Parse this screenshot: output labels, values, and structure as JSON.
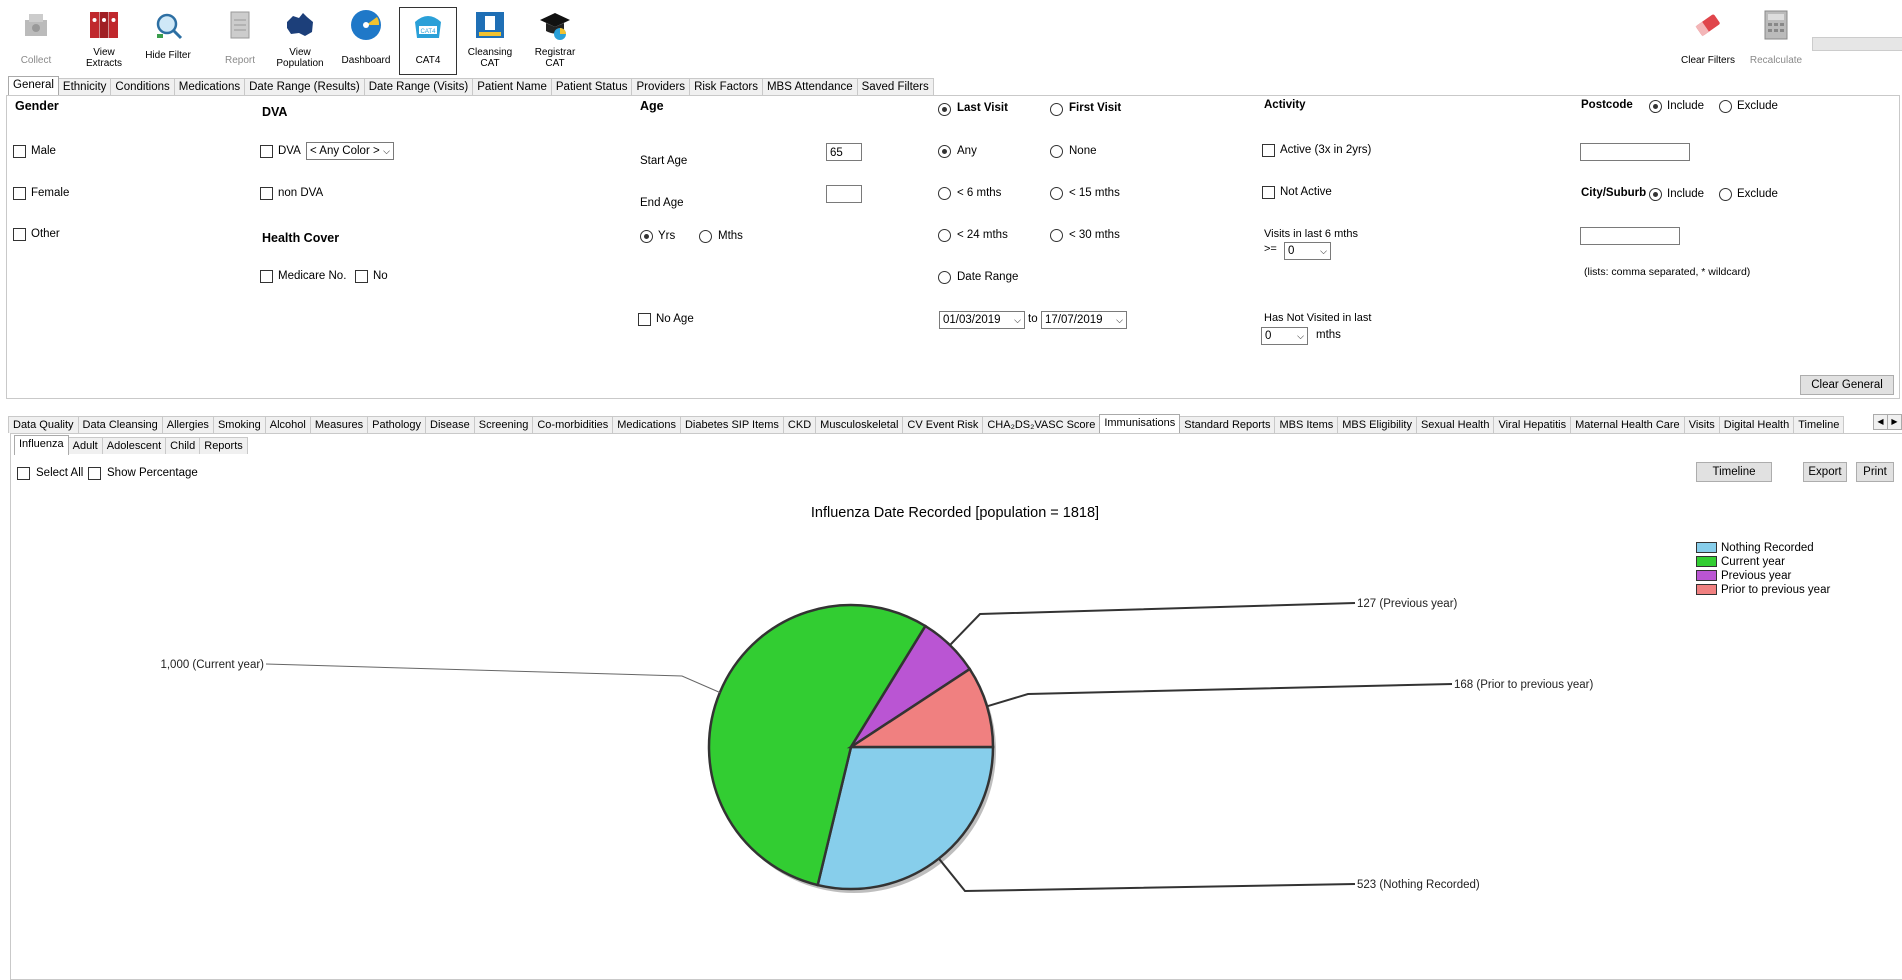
{
  "toolbar": {
    "collect": "Collect",
    "view_extracts": "View\nExtracts",
    "hide_filter": "Hide Filter",
    "report": "Report",
    "view_population": "View\nPopulation",
    "dashboard": "Dashboard",
    "cat4": "CAT4",
    "cleansing_cat": "Cleansing\nCAT",
    "registrar_cat": "Registrar\nCAT",
    "clear_filters": "Clear Filters",
    "recalculate": "Recalculate"
  },
  "filter_tabs": [
    "General",
    "Ethnicity",
    "Conditions",
    "Medications",
    "Date Range (Results)",
    "Date Range (Visits)",
    "Patient Name",
    "Patient Status",
    "Providers",
    "Risk Factors",
    "MBS Attendance",
    "Saved Filters"
  ],
  "general": {
    "gender": {
      "title": "Gender",
      "male": "Male",
      "female": "Female",
      "other": "Other"
    },
    "dva": {
      "title": "DVA",
      "dva": "DVA",
      "any_color": "< Any Color >",
      "non_dva": "non DVA"
    },
    "health_cover": {
      "title": "Health Cover",
      "medicare": "Medicare No.",
      "no": "No"
    },
    "age": {
      "title": "Age",
      "start_age": "Start Age",
      "start_value": "65",
      "end_age": "End Age",
      "end_value": "",
      "yrs": "Yrs",
      "mths": "Mths",
      "no_age": "No Age"
    },
    "visit": {
      "last_visit": "Last Visit",
      "first_visit": "First Visit",
      "any": "Any",
      "none": "None",
      "lt6": "< 6 mths",
      "lt15": "< 15 mths",
      "lt24": "< 24 mths",
      "lt30": "< 30 mths",
      "date_range": "Date Range",
      "from": "01/03/2019",
      "to_label": "to",
      "to": "17/07/2019"
    },
    "activity": {
      "title": "Activity",
      "active": "Active (3x in 2yrs)",
      "not_active": "Not Active",
      "visits_label": "Visits in last 6 mths",
      "gte": ">=",
      "visits_value": "0",
      "not_visited": "Has Not Visited in last",
      "not_visited_value": "0",
      "mths": "mths"
    },
    "postcode": {
      "title": "Postcode",
      "include": "Include",
      "exclude": "Exclude"
    },
    "city": {
      "title": "City/Suburb",
      "include": "Include",
      "exclude": "Exclude",
      "hint": "(lists: comma separated, * wildcard)"
    },
    "clear_general": "Clear General"
  },
  "report_tabs": [
    "Data Quality",
    "Data Cleansing",
    "Allergies",
    "Smoking",
    "Alcohol",
    "Measures",
    "Pathology",
    "Disease",
    "Screening",
    "Co-morbidities",
    "Medications",
    "Diabetes SIP Items",
    "CKD",
    "Musculoskeletal",
    "CV Event Risk",
    "CHA₂DS₂VASC Score",
    "Immunisations",
    "Standard Reports",
    "MBS Items",
    "MBS Eligibility",
    "Sexual Health",
    "Viral Hepatitis",
    "Maternal Health Care",
    "Visits",
    "Digital Health",
    "Timeline"
  ],
  "sub_tabs": [
    "Influenza",
    "Adult",
    "Adolescent",
    "Child",
    "Reports"
  ],
  "options": {
    "select_all": "Select All",
    "show_percentage": "Show Percentage",
    "timeline": "Timeline",
    "export": "Export",
    "print": "Print"
  },
  "colors": {
    "nothing": "#87ceeb",
    "current": "#32cd32",
    "previous": "#ba55d3",
    "prior": "#f08080"
  },
  "chart_data": {
    "type": "pie",
    "title": "Influenza Date Recorded [population = 1818]",
    "categories": [
      "Nothing Recorded",
      "Current year",
      "Previous year",
      "Prior to previous year"
    ],
    "values": [
      523,
      1000,
      127,
      168
    ],
    "data_labels": [
      "523 (Nothing Recorded)",
      "1,000 (Current year)",
      "127 (Previous year)",
      "168 (Prior to previous year)"
    ],
    "legend": "top-right"
  }
}
